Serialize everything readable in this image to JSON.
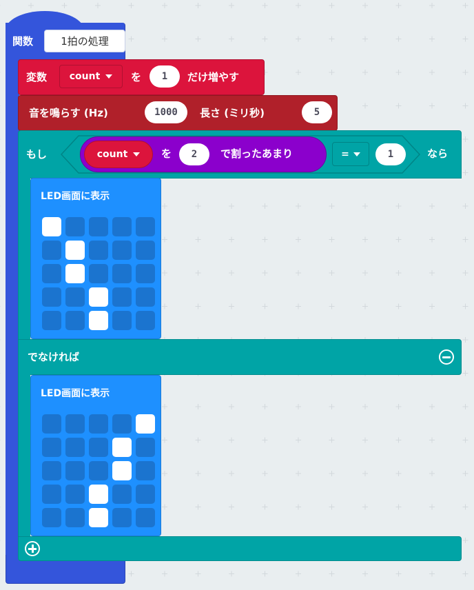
{
  "function_block": {
    "keyword": "関数",
    "name": "1拍の処理"
  },
  "change_var_block": {
    "keyword": "変数",
    "variable": "count",
    "particle": "を",
    "amount": "1",
    "suffix": "だけ増やす"
  },
  "tone_block": {
    "label": "音を鳴らす (Hz)",
    "frequency": "1000",
    "duration_label": "長さ (ミリ秒)",
    "duration": "5"
  },
  "if_block": {
    "if_label": "もし",
    "then_label": "なら",
    "else_label": "でなければ",
    "condition": {
      "variable": "count",
      "particle": "を",
      "divisor": "2",
      "remainder_label": "で割ったあまり",
      "operator": "=",
      "value": "1"
    }
  },
  "led_blocks": [
    {
      "label": "LED画面に表示",
      "pattern": [
        [
          1,
          0,
          0,
          0,
          0
        ],
        [
          0,
          1,
          0,
          0,
          0
        ],
        [
          0,
          1,
          0,
          0,
          0
        ],
        [
          0,
          0,
          1,
          0,
          0
        ],
        [
          0,
          0,
          1,
          0,
          0
        ]
      ]
    },
    {
      "label": "LED画面に表示",
      "pattern": [
        [
          0,
          0,
          0,
          0,
          1
        ],
        [
          0,
          0,
          0,
          1,
          0
        ],
        [
          0,
          0,
          0,
          1,
          0
        ],
        [
          0,
          0,
          1,
          0,
          0
        ],
        [
          0,
          0,
          1,
          0,
          0
        ]
      ]
    }
  ],
  "icons": {
    "remove_else": "minus-circle-icon",
    "add_else": "plus-circle-icon"
  },
  "colors": {
    "function": "#3455db",
    "variables": "#dc143c",
    "music": "#b0202a",
    "logic": "#00a4a6",
    "math": "#8b00cc",
    "basic": "#1e90ff",
    "workspace": "#e9eef0"
  }
}
